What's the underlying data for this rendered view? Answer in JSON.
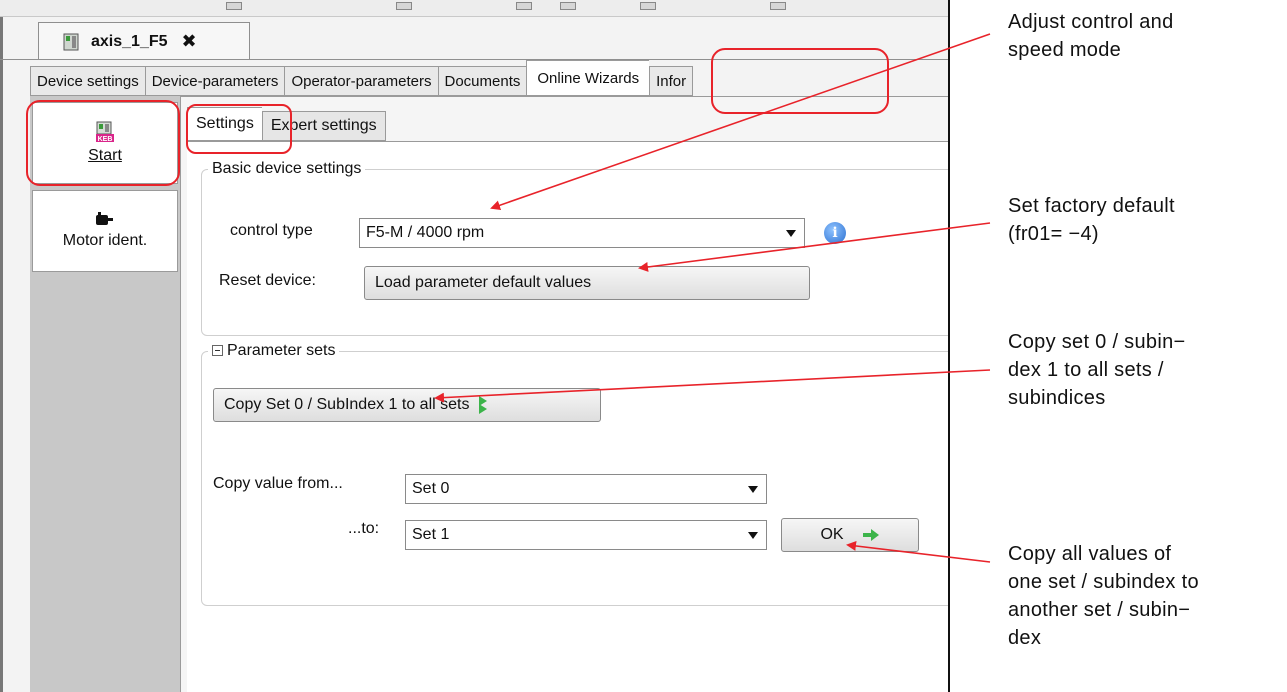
{
  "document_tab": {
    "title": "axis_1_F5",
    "close_glyph": "✖"
  },
  "main_tabs": [
    {
      "label": "Device settings"
    },
    {
      "label": "Device-parameters"
    },
    {
      "label": "Operator-parameters"
    },
    {
      "label": "Documents"
    },
    {
      "label": "Online Wizards",
      "active": true
    },
    {
      "label": "Infor"
    }
  ],
  "side_panel": {
    "items": [
      {
        "label": "Start",
        "icon": "keb-drive-icon",
        "active": true
      },
      {
        "label": "Motor ident.",
        "icon": "motor-icon"
      }
    ]
  },
  "sub_tabs": [
    {
      "label": "Settings",
      "active": true
    },
    {
      "label": "Expert settings"
    }
  ],
  "basic_settings": {
    "legend": "Basic device settings",
    "control_type_label": "control type",
    "control_type_value": "F5-M / 4000 rpm",
    "info_glyph": "i",
    "reset_label": "Reset device:",
    "reset_button": "Load parameter default values"
  },
  "parameter_sets": {
    "legend": "Parameter sets",
    "copy_button": "Copy Set 0 / SubIndex 1 to all sets",
    "copy_from_label": "Copy value from...",
    "copy_from_value": "Set 0",
    "copy_to_label": "...to:",
    "copy_to_value": "Set 1",
    "ok_button": "OK"
  },
  "annotations": {
    "control_mode": [
      "Adjust control and",
      "speed mode"
    ],
    "factory_default": [
      "Set factory default",
      "(fr01= −4)"
    ],
    "copy_all": [
      "Copy set 0 / subin−",
      "dex 1 to all sets /",
      "subindices"
    ],
    "copy_values": [
      "Copy all values of",
      "one set / subindex to",
      "another set / subin−",
      "dex"
    ]
  },
  "colors": {
    "highlight": "#e8232a",
    "arrow": "#e8232a",
    "info_icon": "#2a6fd0",
    "go_arrow": "#3cb44a"
  }
}
